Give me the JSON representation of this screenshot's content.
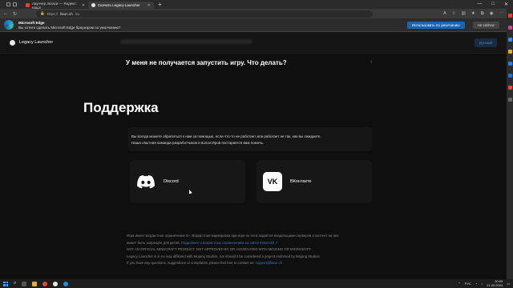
{
  "browser": {
    "tabs": [
      {
        "label": "лаунчер легаси — Яндекс: нашл",
        "color": "#d64a2c",
        "active": false
      },
      {
        "label": "Скачать Legacy Launcher",
        "color": "#e6e6e6",
        "active": true
      }
    ],
    "window_controls": [
      "—",
      "□",
      "✕"
    ],
    "url_prefix": "https://",
    "url_host": "llaun.ch",
    "url_path": "/ru"
  },
  "notification": {
    "title": "Microsoft Edge",
    "message": "Вы хотите сделать Microsoft Edge браузером по умолчанию?",
    "primary_button": "Использовать по умолчанию",
    "secondary_button": "Не сейчас"
  },
  "site": {
    "brand": "Legacy Launcher",
    "header_button": "русский"
  },
  "faq": {
    "question": "У меня не получается запустить игру. Что делать?",
    "chevron": "‹"
  },
  "support": {
    "title": "Поддержка",
    "info_line1": "Вы всегда можете обратиться к нам за помощью, если что-то не работает или работает не так, как вы ожидаете.",
    "info_line2": "Наша опытная команда разработчиков и волонтёров постарается вам помочь.",
    "discord_label": "Discord",
    "vk_label": "ВКонтакте",
    "vk_glyph": "VK"
  },
  "footer": {
    "line1": "Игра имеет возрастное ограничение 6+. Возрастная маркировка при игре по сети задаётся владельцами серверов и контент на них",
    "line2_text": "может быть запрещён для детей.",
    "line2_link": "Подробнее о возрастных ограничениях на сайте Minecraft ↗",
    "line3": "NOT AN OFFICIAL MINECRAFT PRODUCT. NOT APPROVED BY OR ASSOCIATED WITH MOJANG OR MICROSOFT.",
    "line4": "Legacy Launcher is in no way affiliated with Mojang Studios, nor should it be considered a project endorsed by Mojang Studios.",
    "line5_text": "If you have any questions, suggestions or complaints, please feel free to contact us:",
    "line5_link": "support@llaun.ch"
  },
  "taskbar": {
    "lang": "РУС",
    "time": "20:09",
    "date": "21.05.2024"
  }
}
